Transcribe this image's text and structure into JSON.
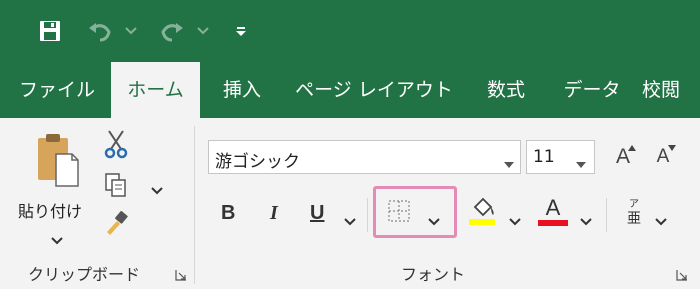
{
  "tabs": [
    {
      "label": "ファイル"
    },
    {
      "label": "ホーム"
    },
    {
      "label": "挿入"
    },
    {
      "label": "ページ レイアウト"
    },
    {
      "label": "数式"
    },
    {
      "label": "データ"
    },
    {
      "label": "校閲"
    }
  ],
  "clipboard": {
    "paste_label": "貼り付け",
    "group_label": "クリップボード"
  },
  "font": {
    "name": "游ゴシック",
    "size": "11",
    "bold": "B",
    "italic": "I",
    "underline": "U",
    "font_color_glyph": "A",
    "grow_glyph": "A",
    "shrink_glyph": "A",
    "phonetic_top": "ア",
    "phonetic_bottom": "亜",
    "group_label": "フォント"
  },
  "colors": {
    "ribbon_green": "#217346",
    "highlight_yellow": "#ffff00",
    "font_red": "#e81123",
    "selection_outline": "#e48bb8"
  }
}
